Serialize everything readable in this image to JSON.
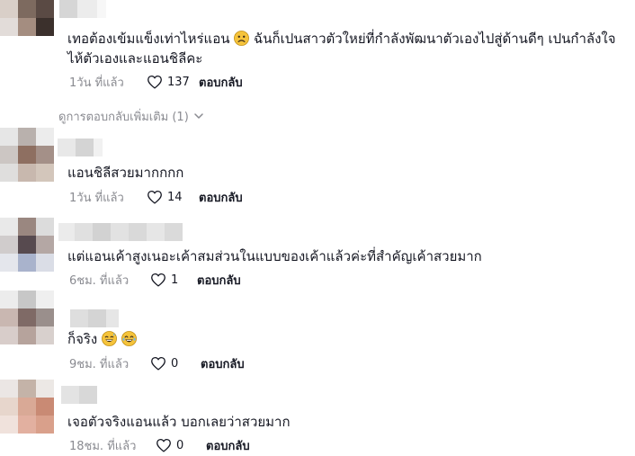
{
  "comments": [
    {
      "text_line1": "เทอต้องเข้มแข็งเท่าไหร่แอน",
      "text_line1_after": "ฉันก็เปนสาวตัวใหย่ที่กำลังพัฒนาตัวเองไปสู่ด้านดีๆ เปนกำลังใจ",
      "text_line2": "ไห้ตัวเองและแอนชิลีคะ",
      "time": "1วัน ที่แล้ว",
      "likes": "137",
      "reply_label": "ตอบกลับ",
      "emoji": "frowning-face"
    },
    {
      "text": "แอนชิลีสวยมากกกก",
      "time": "1วัน ที่แล้ว",
      "likes": "14",
      "reply_label": "ตอบกลับ"
    },
    {
      "text": "แต่แอนเค้าสูงเนอะเค้าสมส่วนในแบบของเค้าแล้วค่ะที่สำคัญเค้าสวยมาก",
      "time": "6ชม. ที่แล้ว",
      "likes": "1",
      "reply_label": "ตอบกลับ"
    },
    {
      "text": "ก็จริง",
      "time": "9ชม. ที่แล้ว",
      "likes": "0",
      "reply_label": "ตอบกลับ",
      "emoji": [
        "grinning-sweat-face",
        "tears-of-joy-face"
      ]
    },
    {
      "text": "เจอตัวจริงแอนแล้ว บอกเลยว่าสวยมาก",
      "time": "18ชม. ที่แล้ว",
      "likes": "0",
      "reply_label": "ตอบกลับ"
    }
  ],
  "view_more_replies": "ดูการตอบกลับเพิ่มเติม (1)",
  "colors": {
    "text": "#161823",
    "meta": "#8a8b91",
    "background": "#ffffff"
  },
  "icons": [
    "heart-outline-icon",
    "chevron-down-icon"
  ]
}
